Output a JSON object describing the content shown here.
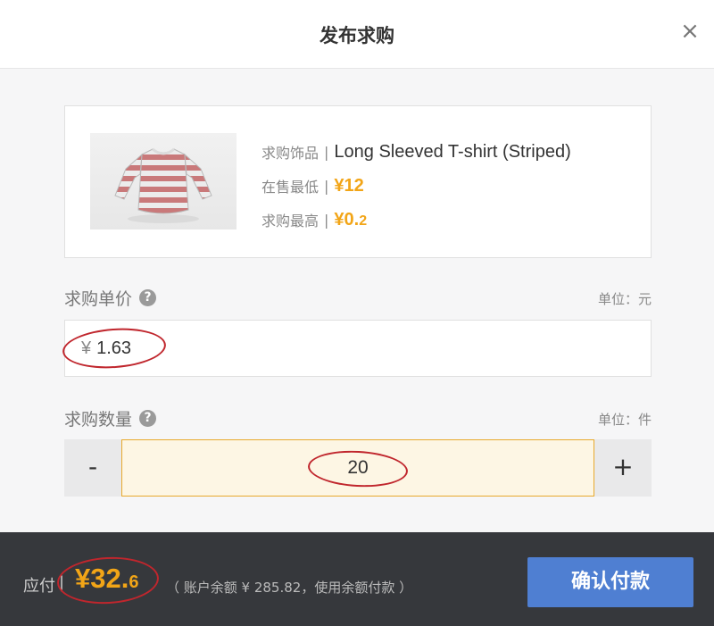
{
  "dialog": {
    "title": "发布求购",
    "close_icon": "×"
  },
  "product": {
    "item_label": "求购饰品",
    "item_name": "Long Sleeved T-shirt (Striped)",
    "lowest_label": "在售最低",
    "lowest_price": "¥12",
    "highest_label": "求购最高",
    "highest_price_main": "¥0.",
    "highest_price_small": "2",
    "image_icon": "striped-tshirt-image"
  },
  "unit_price": {
    "label": "求购单价",
    "help_icon": "?",
    "unit": "单位：元",
    "currency": "¥",
    "value": "1.63"
  },
  "quantity": {
    "label": "求购数量",
    "help_icon": "?",
    "unit": "单位：件",
    "minus": "-",
    "plus": "+",
    "value": "20"
  },
  "footer": {
    "pay_label": "应付",
    "separator": "|",
    "amount_main": "¥32.",
    "amount_small": "6",
    "balance_text": "（ 账户余额 ¥ 285.82，使用余额付款 ）",
    "confirm_label": "确认付款"
  },
  "colors": {
    "accent_orange": "#f2a517",
    "confirm_blue": "#4f7fd2",
    "annotation_red": "#c0262d"
  }
}
